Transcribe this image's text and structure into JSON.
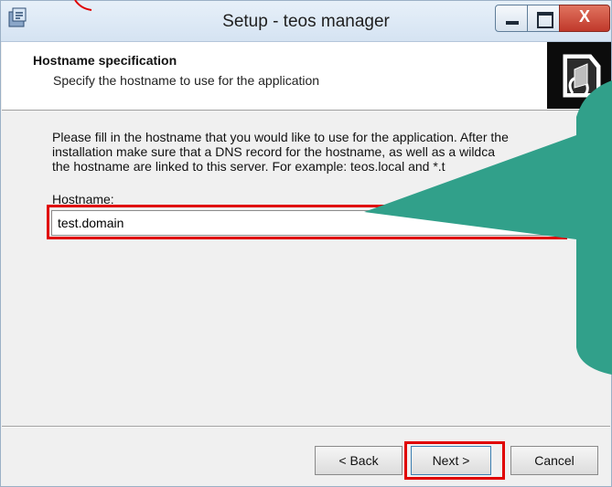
{
  "window": {
    "title": "Setup - teos manager",
    "controls": {
      "minimize": "minimize",
      "maximize": "maximize",
      "close": "X"
    }
  },
  "header": {
    "title": "Hostname specification",
    "subtitle": "Specify the hostname to use for the application"
  },
  "content": {
    "description_lines": [
      "Please fill in the hostname that you would like to use for the application. After the",
      "installation make sure that a DNS record for the hostname, as well as a wildca",
      "the hostname are linked to this server. For example: teos.local and *.t"
    ],
    "hostname_label": "Hostname:",
    "hostname_value": "test.domain"
  },
  "buttons": {
    "back": "< Back",
    "next": "Next >",
    "cancel": "Cancel"
  },
  "colors": {
    "highlight": "#e00000",
    "callout": "#31a08a"
  }
}
